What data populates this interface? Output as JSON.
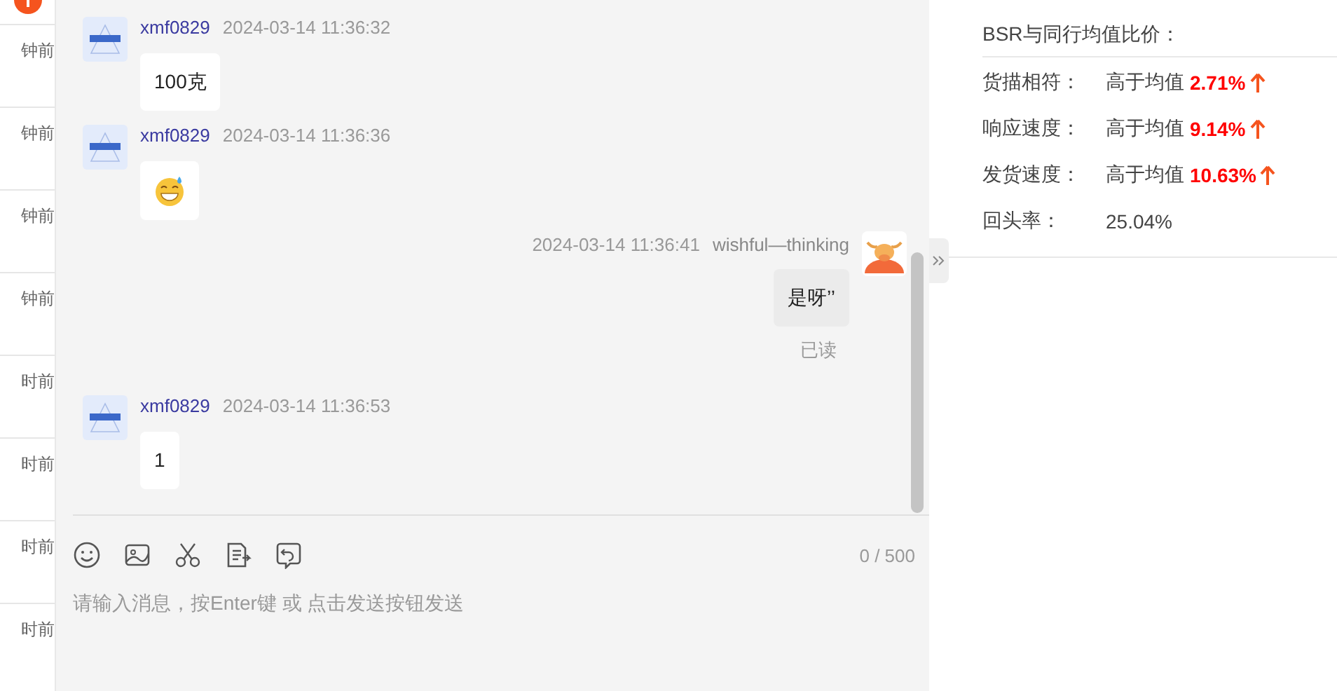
{
  "conversation_list": {
    "items": [
      {
        "time": "钟前"
      },
      {
        "time": "钟前"
      },
      {
        "time": "钟前"
      },
      {
        "time": "钟前"
      },
      {
        "time": "时前"
      },
      {
        "time": "时前"
      },
      {
        "time": "时前"
      },
      {
        "time": "时前"
      }
    ]
  },
  "messages": [
    {
      "outgoing": false,
      "kind": "text",
      "sender": "xmf0829",
      "time": "2024-03-14 11:36:32",
      "text": "100克"
    },
    {
      "outgoing": false,
      "kind": "emoji",
      "sender": "xmf0829",
      "time": "2024-03-14 11:36:36"
    },
    {
      "outgoing": true,
      "kind": "text",
      "sender": "wishful—thinking",
      "time": "2024-03-14 11:36:41",
      "text": "是呀’’",
      "status": "已读"
    },
    {
      "outgoing": false,
      "kind": "text",
      "sender": "xmf0829",
      "time": "2024-03-14 11:36:53",
      "text": "1"
    }
  ],
  "composer": {
    "tools": [
      {
        "kind": "emoji"
      },
      {
        "kind": "image"
      },
      {
        "kind": "scissors"
      },
      {
        "kind": "document"
      },
      {
        "kind": "undo"
      }
    ],
    "counter": "0 / 500",
    "placeholder": "请输入消息，按Enter键 或 点击发送按钮发送"
  },
  "stats": {
    "title": "BSR与同行均值比价：",
    "rows": [
      {
        "label": "货描相符：",
        "value": "高于均值",
        "percent": "2.71%",
        "rising": true
      },
      {
        "label": "响应速度：",
        "value": "高于均值",
        "percent": "9.14%",
        "rising": true
      },
      {
        "label": "发货速度：",
        "value": "高于均值",
        "percent": "10.63%",
        "rising": true
      },
      {
        "label": "回头率：",
        "value": "25.04%",
        "rising": false
      }
    ]
  }
}
